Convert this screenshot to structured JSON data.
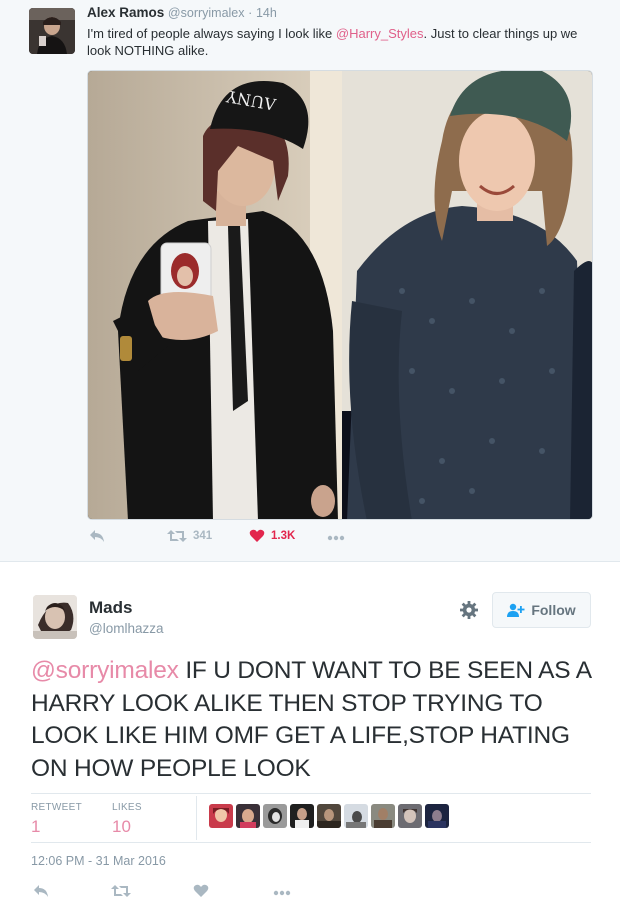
{
  "quoted_tweet": {
    "name": "Alex Ramos",
    "handle": "@sorryimalex",
    "separator": "·",
    "time": "14h",
    "text_before": "I'm tired of people always saying I look like ",
    "mention": "@Harry_Styles",
    "text_after": ". Just to clear things up we look NOTHING alike.",
    "beanie_text": "ΛUNY",
    "retweet_count": "341",
    "like_count": "1.3K"
  },
  "main_tweet": {
    "name": "Mads",
    "handle": "@lomlhazza",
    "follow_label": "Follow",
    "mention": "@sorryimalex",
    "text": " IF U DONT WANT TO BE SEEN AS A HARRY LOOK ALIKE THEN STOP TRYING TO LOOK LIKE HIM OMF GET A LIFE,STOP HATING ON HOW PEOPLE LOOK",
    "retweets_label": "RETWEET",
    "retweets_value": "1",
    "likes_label": "LIKES",
    "likes_value": "10",
    "timestamp": "12:06 PM - 31 Mar 2016"
  },
  "icons": {
    "reply": "reply-icon",
    "retweet": "retweet-icon",
    "like": "heart-icon",
    "more": "more-icon",
    "gear": "gear-icon",
    "follow": "add-user-icon"
  },
  "colors": {
    "mention": "#e0608a",
    "like_active": "#e2264d",
    "muted": "#8899a6",
    "panel": "#f5f8fa"
  }
}
